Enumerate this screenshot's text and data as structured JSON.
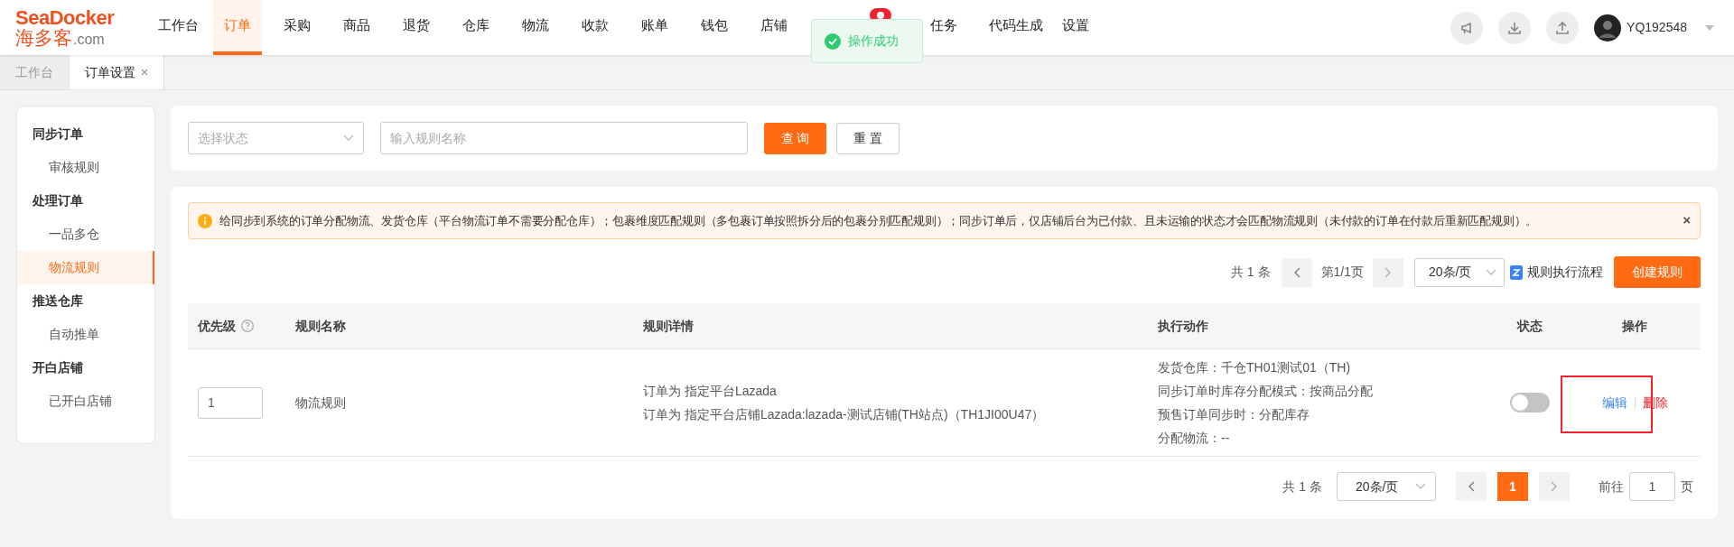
{
  "logo": {
    "brand": "SeaDocker",
    "cn": "海多客",
    "domain": ".com"
  },
  "nav": [
    {
      "label": "工作台",
      "selected": false,
      "badge": false
    },
    {
      "label": "订单",
      "selected": true,
      "badge": false
    },
    {
      "label": "采购",
      "selected": false,
      "badge": false
    },
    {
      "label": "商品",
      "selected": false,
      "badge": false
    },
    {
      "label": "退货",
      "selected": false,
      "badge": false
    },
    {
      "label": "仓库",
      "selected": false,
      "badge": false
    },
    {
      "label": "物流",
      "selected": false,
      "badge": false
    },
    {
      "label": "收款",
      "selected": false,
      "badge": false
    },
    {
      "label": "账单",
      "selected": false,
      "badge": false
    },
    {
      "label": "钱包",
      "selected": false,
      "badge": false
    },
    {
      "label": "店铺",
      "selected": false,
      "badge": false
    },
    {
      "label": "任务",
      "selected": false,
      "badge": true
    },
    {
      "label": "代码生成",
      "selected": false,
      "badge": false
    },
    {
      "label": "设置",
      "selected": false,
      "badge": false
    }
  ],
  "toast": {
    "text": "操作成功"
  },
  "user": {
    "name": "YQ192548"
  },
  "tabs": [
    {
      "label": "工作台",
      "selected": false,
      "closable": false
    },
    {
      "label": "订单设置",
      "selected": true,
      "closable": true
    }
  ],
  "sidebar": [
    {
      "label": "同步订单",
      "children": [
        {
          "label": "审核规则",
          "selected": false
        }
      ]
    },
    {
      "label": "处理订单",
      "children": [
        {
          "label": "一品多仓",
          "selected": false
        },
        {
          "label": "物流规则",
          "selected": true
        }
      ]
    },
    {
      "label": "推送仓库",
      "children": [
        {
          "label": "自动推单",
          "selected": false
        }
      ]
    },
    {
      "label": "开白店铺",
      "children": [
        {
          "label": "已开白店铺",
          "selected": false
        }
      ]
    }
  ],
  "filter": {
    "status_placeholder": "选择状态",
    "name_placeholder": "输入规则名称",
    "search_button": "查 询",
    "reset_button": "重 置"
  },
  "notice": {
    "text": "给同步到系统的订单分配物流、发货仓库（平台物流订单不需要分配仓库）；包裹维度匹配规则（多包裹订单按照拆分后的包裹分别匹配规则）；同步订单后，仅店铺后台为已付款、且未运输的状态才会匹配物流规则（未付款的订单在付款后重新匹配规则）。",
    "close": "×"
  },
  "toolbar": {
    "total": "共 1 条",
    "page": "第1/1页",
    "page_size": "20条/页",
    "flow_link": "规则执行流程",
    "create_button": "创建规则"
  },
  "table": {
    "columns": [
      "优先级",
      "规则名称",
      "规则详情",
      "执行动作",
      "状态",
      "操作"
    ],
    "rows": [
      {
        "priority": "1",
        "name": "物流规则",
        "details": [
          "订单为 指定平台Lazada",
          "订单为 指定平台店铺Lazada:lazada-测试店铺(TH站点)（TH1JI00U47）"
        ],
        "actions": [
          "发货仓库：千仓TH01测试01（TH)",
          "同步订单时库存分配模式：按商品分配",
          "预售订单同步时：分配库存",
          "分配物流：--"
        ],
        "on": false,
        "operations": [
          "编辑",
          "删除"
        ]
      }
    ]
  },
  "pagination": {
    "total": "共 1 条",
    "page_size": "20条/页",
    "pages": [
      {
        "label": "1",
        "selected": true
      }
    ],
    "goto_label": "前往",
    "goto_value": "1",
    "goto_suffix": "页"
  }
}
